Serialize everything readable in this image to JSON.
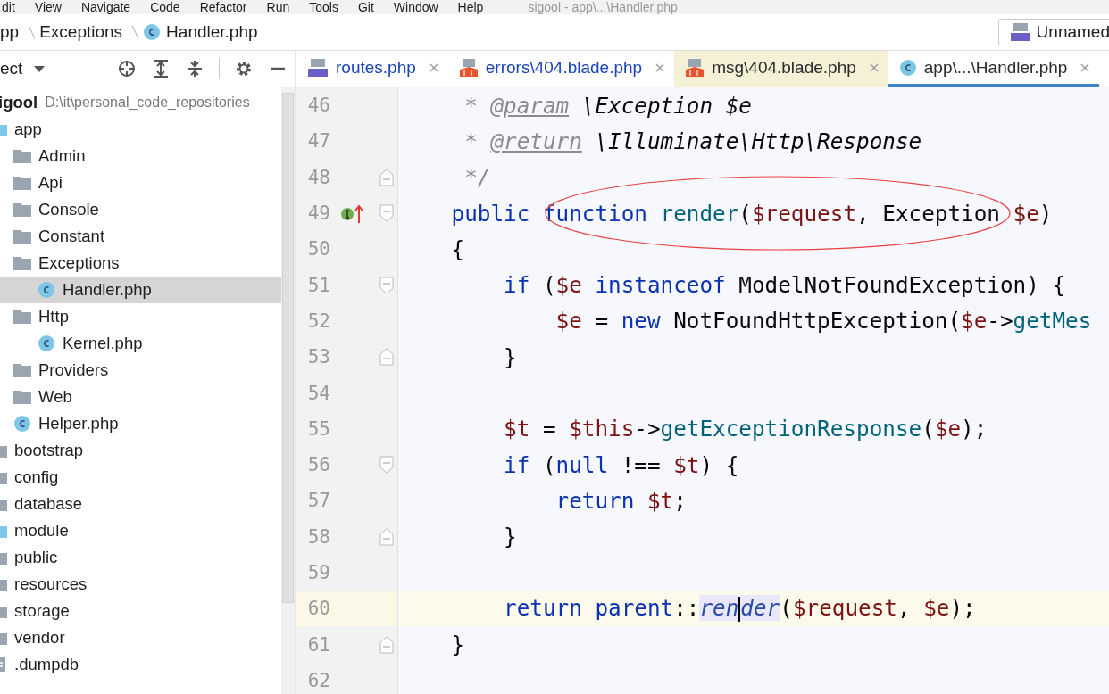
{
  "menu_bar": {
    "items": [
      "dit",
      "View",
      "Navigate",
      "Code",
      "Refactor",
      "Run",
      "Tools",
      "Git",
      "Window",
      "Help"
    ],
    "title": "sigool - app\\...\\Handler.php"
  },
  "breadcrumb": [
    {
      "label": "pp",
      "kind": "folder"
    },
    {
      "label": "Exceptions",
      "kind": "folder"
    },
    {
      "label": "Handler.php",
      "kind": "class"
    }
  ],
  "run_config": {
    "label": "Unnamed"
  },
  "project_panel": {
    "title": "ect"
  },
  "tabs": [
    {
      "label": "routes.php",
      "kind": "php",
      "color": "#1a44b8",
      "highlighted": false,
      "selected": false
    },
    {
      "label": "errors\\404.blade.php",
      "kind": "blade",
      "color": "#1a44b8",
      "highlighted": false,
      "selected": false
    },
    {
      "label": "msg\\404.blade.php",
      "kind": "blade",
      "color": "#2b2b2b",
      "highlighted": true,
      "selected": false
    },
    {
      "label": "app\\...\\Handler.php",
      "kind": "class",
      "color": "#2b2b2b",
      "highlighted": false,
      "selected": true
    }
  ],
  "tree": {
    "root": {
      "name": "igool",
      "path": "D:\\it\\personal_code_repositories"
    },
    "items": [
      {
        "label": "app",
        "kind": "source-folder",
        "selected": false,
        "children": [
          {
            "label": "Admin",
            "kind": "folder",
            "selected": false
          },
          {
            "label": "Api",
            "kind": "folder",
            "selected": false
          },
          {
            "label": "Console",
            "kind": "folder",
            "selected": false
          },
          {
            "label": "Constant",
            "kind": "folder",
            "selected": false
          },
          {
            "label": "Exceptions",
            "kind": "folder",
            "selected": false,
            "children": [
              {
                "label": "Handler.php",
                "kind": "class",
                "selected": true
              }
            ]
          },
          {
            "label": "Http",
            "kind": "folder",
            "selected": false,
            "children": [
              {
                "label": "Kernel.php",
                "kind": "class",
                "selected": false
              }
            ]
          },
          {
            "label": "Providers",
            "kind": "folder",
            "selected": false
          },
          {
            "label": "Web",
            "kind": "folder",
            "selected": false
          },
          {
            "label": "Helper.php",
            "kind": "class",
            "selected": false
          }
        ]
      },
      {
        "label": "bootstrap",
        "kind": "folder",
        "selected": false
      },
      {
        "label": "config",
        "kind": "folder",
        "selected": false
      },
      {
        "label": "database",
        "kind": "folder",
        "selected": false
      },
      {
        "label": "module",
        "kind": "source-folder",
        "selected": false
      },
      {
        "label": "public",
        "kind": "folder",
        "selected": false
      },
      {
        "label": "resources",
        "kind": "folder",
        "selected": false
      },
      {
        "label": "storage",
        "kind": "folder",
        "selected": false
      },
      {
        "label": "vendor",
        "kind": "folder",
        "selected": false
      },
      {
        "label": ".dumpdb",
        "kind": "file",
        "selected": false
      }
    ]
  },
  "editor": {
    "lines": [
      {
        "number": "46",
        "tokens": [
          {
            "text": "     * ",
            "kind": "doc"
          },
          {
            "text": "@param",
            "kind": "doctag"
          },
          {
            "text": " \\Exception $e",
            "kind": "doctype"
          }
        ]
      },
      {
        "number": "47",
        "tokens": [
          {
            "text": "     * ",
            "kind": "doc"
          },
          {
            "text": "@return",
            "kind": "doctag"
          },
          {
            "text": " \\Illuminate\\Http\\Response",
            "kind": "doctype"
          }
        ]
      },
      {
        "number": "48",
        "fold": {
          "kind": "end"
        },
        "tokens": [
          {
            "text": "     */",
            "kind": "doc"
          }
        ]
      },
      {
        "number": "49",
        "fold": {
          "kind": "start"
        },
        "marker": {
          "kind": "implements"
        },
        "tokens": [
          {
            "text": "    public",
            "kind": "kw"
          },
          {
            "text": " function",
            "kind": "kw"
          },
          {
            "text": " render",
            "kind": "fn"
          },
          {
            "text": "(",
            "kind": "plain"
          },
          {
            "text": "$request",
            "kind": "var"
          },
          {
            "text": ", Exception ",
            "kind": "plain"
          },
          {
            "text": "$e",
            "kind": "var"
          },
          {
            "text": ")",
            "kind": "plain"
          }
        ]
      },
      {
        "number": "50",
        "tokens": [
          {
            "text": "    {",
            "kind": "plain"
          }
        ]
      },
      {
        "number": "51",
        "fold": {
          "kind": "start"
        },
        "tokens": [
          {
            "text": "        if",
            "kind": "kw"
          },
          {
            "text": " (",
            "kind": "plain"
          },
          {
            "text": "$e",
            "kind": "var"
          },
          {
            "text": " instanceof",
            "kind": "kw"
          },
          {
            "text": " ModelNotFoundException) {",
            "kind": "plain"
          }
        ]
      },
      {
        "number": "52",
        "tokens": [
          {
            "text": "            $e",
            "kind": "var"
          },
          {
            "text": " = ",
            "kind": "plain"
          },
          {
            "text": "new",
            "kind": "kw"
          },
          {
            "text": " NotFoundHttpException(",
            "kind": "plain"
          },
          {
            "text": "$e",
            "kind": "var"
          },
          {
            "text": "->",
            "kind": "plain"
          },
          {
            "text": "getMes",
            "kind": "fn"
          }
        ]
      },
      {
        "number": "53",
        "fold": {
          "kind": "end"
        },
        "tokens": [
          {
            "text": "        }",
            "kind": "plain"
          }
        ]
      },
      {
        "number": "54"
      },
      {
        "number": "55",
        "tokens": [
          {
            "text": "        $t",
            "kind": "var"
          },
          {
            "text": " = ",
            "kind": "plain"
          },
          {
            "text": "$this",
            "kind": "var"
          },
          {
            "text": "->",
            "kind": "plain"
          },
          {
            "text": "getExceptionResponse",
            "kind": "fn"
          },
          {
            "text": "(",
            "kind": "plain"
          },
          {
            "text": "$e",
            "kind": "var"
          },
          {
            "text": ");",
            "kind": "plain"
          }
        ]
      },
      {
        "number": "56",
        "fold": {
          "kind": "start"
        },
        "tokens": [
          {
            "text": "        if",
            "kind": "kw"
          },
          {
            "text": " (",
            "kind": "plain"
          },
          {
            "text": "null",
            "kind": "kw"
          },
          {
            "text": " !== ",
            "kind": "plain"
          },
          {
            "text": "$t",
            "kind": "var"
          },
          {
            "text": ") {",
            "kind": "plain"
          }
        ]
      },
      {
        "number": "57",
        "tokens": [
          {
            "text": "            return",
            "kind": "kw"
          },
          {
            "text": " $t",
            "kind": "var"
          },
          {
            "text": ";",
            "kind": "plain"
          }
        ]
      },
      {
        "number": "58",
        "fold": {
          "kind": "end"
        },
        "tokens": [
          {
            "text": "        }",
            "kind": "plain"
          }
        ]
      },
      {
        "number": "59"
      },
      {
        "number": "60",
        "current": true,
        "tokens": [
          {
            "text": "        return",
            "kind": "kw"
          },
          {
            "text": " parent",
            "kind": "kw"
          },
          {
            "text": "::",
            "kind": "plain"
          },
          {
            "text": "ren",
            "kind": "call"
          },
          {
            "kind": "caret"
          },
          {
            "text": "der",
            "kind": "call"
          },
          {
            "text": "(",
            "kind": "plain"
          },
          {
            "text": "$request",
            "kind": "var"
          },
          {
            "text": ", ",
            "kind": "plain"
          },
          {
            "text": "$e",
            "kind": "var"
          },
          {
            "text": ");",
            "kind": "plain"
          }
        ]
      },
      {
        "number": "61",
        "fold": {
          "kind": "end"
        },
        "tokens": [
          {
            "text": "    }",
            "kind": "plain"
          }
        ]
      },
      {
        "number": "62"
      }
    ]
  }
}
